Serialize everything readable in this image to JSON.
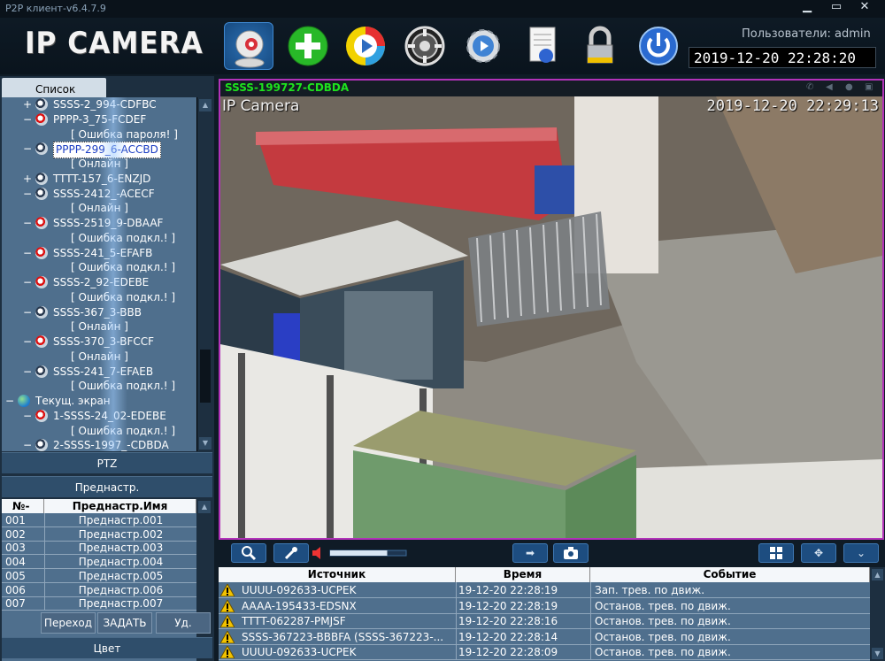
{
  "window": {
    "title": "P2P клиент-v6.4.7.9",
    "controls": [
      "minimize-icon",
      "maximize-icon",
      "close-icon"
    ]
  },
  "header": {
    "logo": "IP CAMERA",
    "toolbar_icons": [
      "camera-view-icon",
      "add-device-icon",
      "playback-icon",
      "ptz-wheel-icon",
      "settings-gear-icon",
      "log-document-icon",
      "lock-icon",
      "power-icon"
    ],
    "users_label": "Пользователи: admin",
    "clock": "2019-12-20  22:28:20"
  },
  "left": {
    "list_tab": "Список",
    "tree": [
      {
        "pm": "+",
        "icon": "cam",
        "text": "SSSS-2_994-CDFBC",
        "indent": 1
      },
      {
        "pm": "−",
        "icon": "cam-red",
        "text": "PPPP-3_75-FCDEF",
        "indent": 1
      },
      {
        "pm": "",
        "icon": "",
        "text": "[  Ошибка пароля!  ]",
        "indent": 2
      },
      {
        "pm": "−",
        "icon": "cam",
        "text": "PPPP-299_6-ACCBD",
        "indent": 1,
        "selected": true
      },
      {
        "pm": "",
        "icon": "",
        "text": "[     Онлайн     ]",
        "indent": 2
      },
      {
        "pm": "+",
        "icon": "cam",
        "text": "TTTT-157_6-ENZJD",
        "indent": 1
      },
      {
        "pm": "−",
        "icon": "cam",
        "text": "SSSS-2412_-ACECF",
        "indent": 1
      },
      {
        "pm": "",
        "icon": "",
        "text": "[     Онлайн     ]",
        "indent": 2
      },
      {
        "pm": "−",
        "icon": "cam-red",
        "text": "SSSS-2519_9-DBAAF",
        "indent": 1
      },
      {
        "pm": "",
        "icon": "",
        "text": "[  Ошибка подкл.!  ]",
        "indent": 2
      },
      {
        "pm": "−",
        "icon": "cam-red",
        "text": "SSSS-241_5-EFAFB",
        "indent": 1
      },
      {
        "pm": "",
        "icon": "",
        "text": "[  Ошибка подкл.!  ]",
        "indent": 2
      },
      {
        "pm": "−",
        "icon": "cam-red",
        "text": "SSSS-2_92-EDEBE",
        "indent": 1
      },
      {
        "pm": "",
        "icon": "",
        "text": "[  Ошибка подкл.!  ]",
        "indent": 2
      },
      {
        "pm": "−",
        "icon": "cam",
        "text": "SSSS-367_3-BBB",
        "indent": 1
      },
      {
        "pm": "",
        "icon": "",
        "text": "[     Онлайн     ]",
        "indent": 2
      },
      {
        "pm": "−",
        "icon": "cam-red",
        "text": "SSSS-370_3-BFCCF",
        "indent": 1
      },
      {
        "pm": "",
        "icon": "",
        "text": "[     Онлайн     ]",
        "indent": 2
      },
      {
        "pm": "−",
        "icon": "cam",
        "text": "SSSS-241_7-EFAEB",
        "indent": 1
      },
      {
        "pm": "",
        "icon": "",
        "text": "[  Ошибка подкл.!  ]",
        "indent": 2
      },
      {
        "pm": "−",
        "icon": "globe",
        "text": "Текущ. экран",
        "indent": 0
      },
      {
        "pm": "−",
        "icon": "cam-red",
        "text": "1-SSSS-24_02-EDEBE",
        "indent": 1
      },
      {
        "pm": "",
        "icon": "",
        "text": "[  Ошибка подкл.!  ]",
        "indent": 2
      },
      {
        "pm": "−",
        "icon": "cam",
        "text": "2-SSSS-1997_-CDBDA",
        "indent": 1
      }
    ],
    "ptz_label": "PTZ",
    "presets_label": "Преднастр.",
    "preset_table": {
      "headers": [
        "№-",
        "Преднастр.Имя"
      ],
      "rows": [
        [
          "001",
          "Преднастр.001"
        ],
        [
          "002",
          "Преднастр.002"
        ],
        [
          "003",
          "Преднастр.003"
        ],
        [
          "004",
          "Преднастр.004"
        ],
        [
          "005",
          "Преднастр.005"
        ],
        [
          "006",
          "Преднастр.006"
        ],
        [
          "007",
          "Преднастр.007"
        ]
      ]
    },
    "buttons": {
      "goto": "Переход",
      "set": "ЗАДАТЬ",
      "delete": "Уд."
    },
    "color_label": "Цвет"
  },
  "video": {
    "channel_name": "SSSS-199727-CDBDA",
    "osd_name": "IP Camera",
    "osd_time": "2019-12-20 22:29:13",
    "title_icons": [
      "talk-icon",
      "speaker-icon",
      "record-icon",
      "fullscreen-icon"
    ]
  },
  "video_toolbar": {
    "left_icons": [
      "zoom-icon",
      "mic-icon"
    ],
    "volume_level": 0.75,
    "center_icons": [
      "forward-arrow-icon",
      "snapshot-icon"
    ],
    "right_icons": [
      "grid-layout-icon",
      "ptz-move-icon",
      "expand-down-icon"
    ]
  },
  "events": {
    "headers": [
      "Источник",
      "Время",
      "Событие"
    ],
    "rows": [
      {
        "source": "UUUU-092633-UCPEK",
        "time": "19-12-20 22:28:19",
        "event": "Зап. трев. по движ."
      },
      {
        "source": "AAAA-195433-EDSNX",
        "time": "19-12-20 22:28:19",
        "event": "Останов. трев. по движ."
      },
      {
        "source": "TTTT-062287-PMJSF",
        "time": "19-12-20 22:28:16",
        "event": "Останов. трев. по движ."
      },
      {
        "source": "SSSS-367223-BBBFA (SSSS-367223-...",
        "time": "19-12-20 22:28:14",
        "event": "Останов. трев. по движ."
      },
      {
        "source": "UUUU-092633-UCPEK",
        "time": "19-12-20 22:28:09",
        "event": "Останов. трев. по движ."
      }
    ]
  },
  "colors": {
    "accent_border": "#b232b9",
    "channel_name": "#1ee31e",
    "panel_bg": "#4f6f8d"
  }
}
